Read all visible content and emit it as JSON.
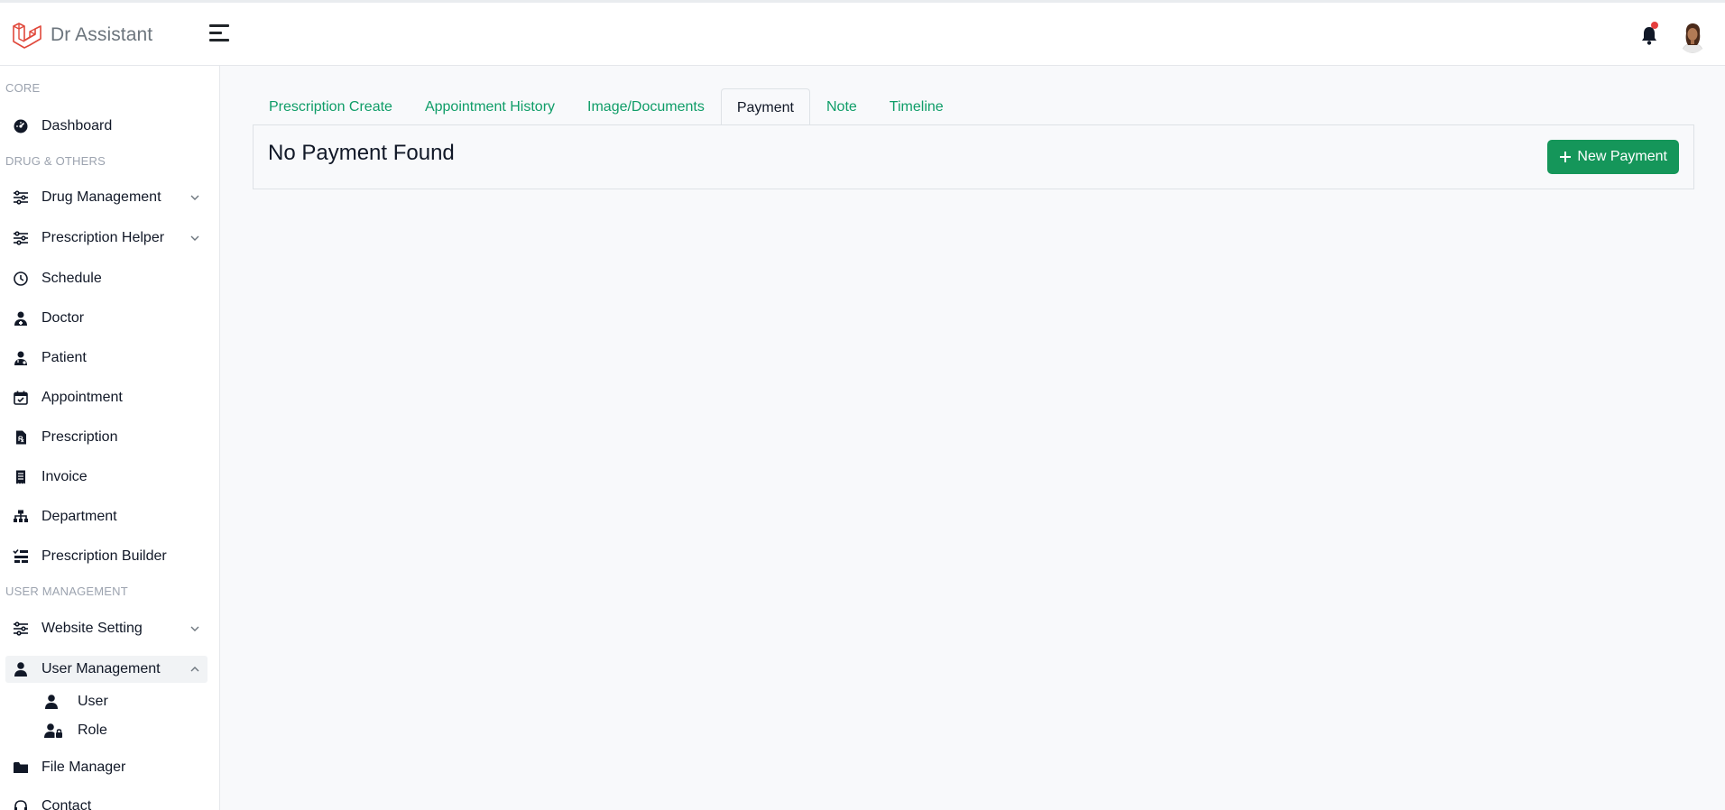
{
  "brand": {
    "name": "Dr Assistant"
  },
  "sidebar": {
    "sections": [
      "CORE",
      "DRUG & OTHERS",
      "USER MANAGEMENT"
    ],
    "items": [
      {
        "label": "Dashboard"
      },
      {
        "label": "Drug Management"
      },
      {
        "label": "Prescription Helper"
      },
      {
        "label": "Schedule"
      },
      {
        "label": "Doctor"
      },
      {
        "label": "Patient"
      },
      {
        "label": "Appointment"
      },
      {
        "label": "Prescription"
      },
      {
        "label": "Invoice"
      },
      {
        "label": "Department"
      },
      {
        "label": "Prescription Builder"
      },
      {
        "label": "Website Setting"
      },
      {
        "label": "User Management"
      },
      {
        "label": "User"
      },
      {
        "label": "Role"
      },
      {
        "label": "File Manager"
      },
      {
        "label": "Contact"
      }
    ]
  },
  "tabs": [
    {
      "label": "Prescription Create"
    },
    {
      "label": "Appointment History"
    },
    {
      "label": "Image/Documents"
    },
    {
      "label": "Payment"
    },
    {
      "label": "Note"
    },
    {
      "label": "Timeline"
    }
  ],
  "panel": {
    "title": "No Payment Found",
    "new_button": "New Payment"
  },
  "colors": {
    "accent": "#15965a",
    "link": "#0f9d68",
    "notification": "#e53e3e",
    "brand_logo": "#e0483b"
  }
}
